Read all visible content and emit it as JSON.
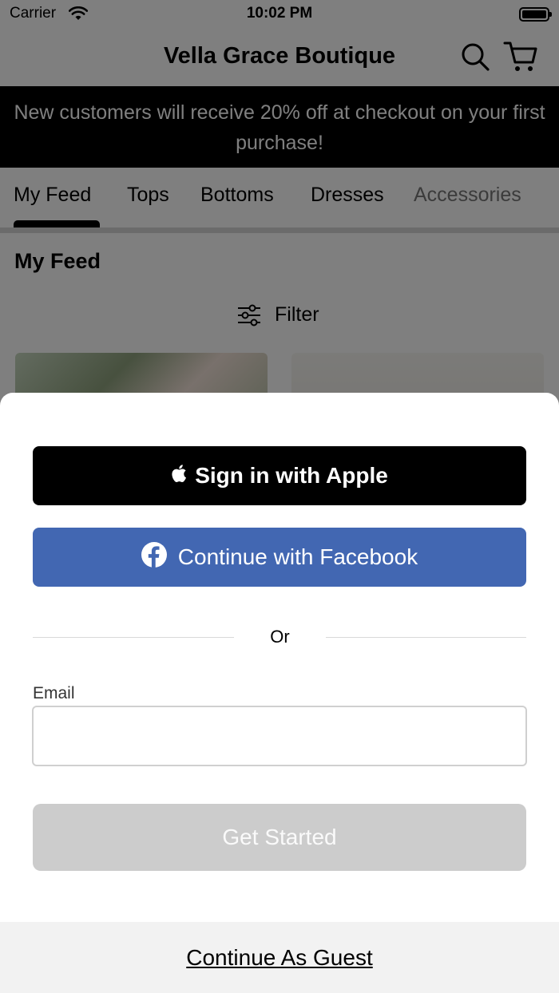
{
  "status_bar": {
    "carrier": "Carrier",
    "time": "10:02 PM"
  },
  "nav": {
    "title": "Vella Grace Boutique",
    "search_icon": "search-icon",
    "cart_icon": "cart-icon"
  },
  "promo": {
    "text": "New customers will receive 20% off at checkout on your first purchase!"
  },
  "tabs": {
    "items": [
      {
        "label": "My Feed",
        "selected": true
      },
      {
        "label": "Tops",
        "selected": false
      },
      {
        "label": "Bottoms",
        "selected": false
      },
      {
        "label": "Dresses",
        "selected": false
      },
      {
        "label": "Accessories",
        "selected": false
      }
    ]
  },
  "feed": {
    "heading": "My Feed",
    "filter_label": "Filter",
    "filter_icon": "sliders-icon"
  },
  "sheet": {
    "apple_label": "Sign in with Apple",
    "facebook_label": "Continue with Facebook",
    "divider_text": "Or",
    "email_label": "Email",
    "email_value": "",
    "email_placeholder": "",
    "get_started_label": "Get Started",
    "guest_label": "Continue As Guest"
  },
  "colors": {
    "facebook_blue": "#4267b2",
    "apple_black": "#000000",
    "disabled_button": "#cccccc",
    "overlay": "rgba(0,0,0,0.5)",
    "guest_bar": "#f2f2f2"
  }
}
